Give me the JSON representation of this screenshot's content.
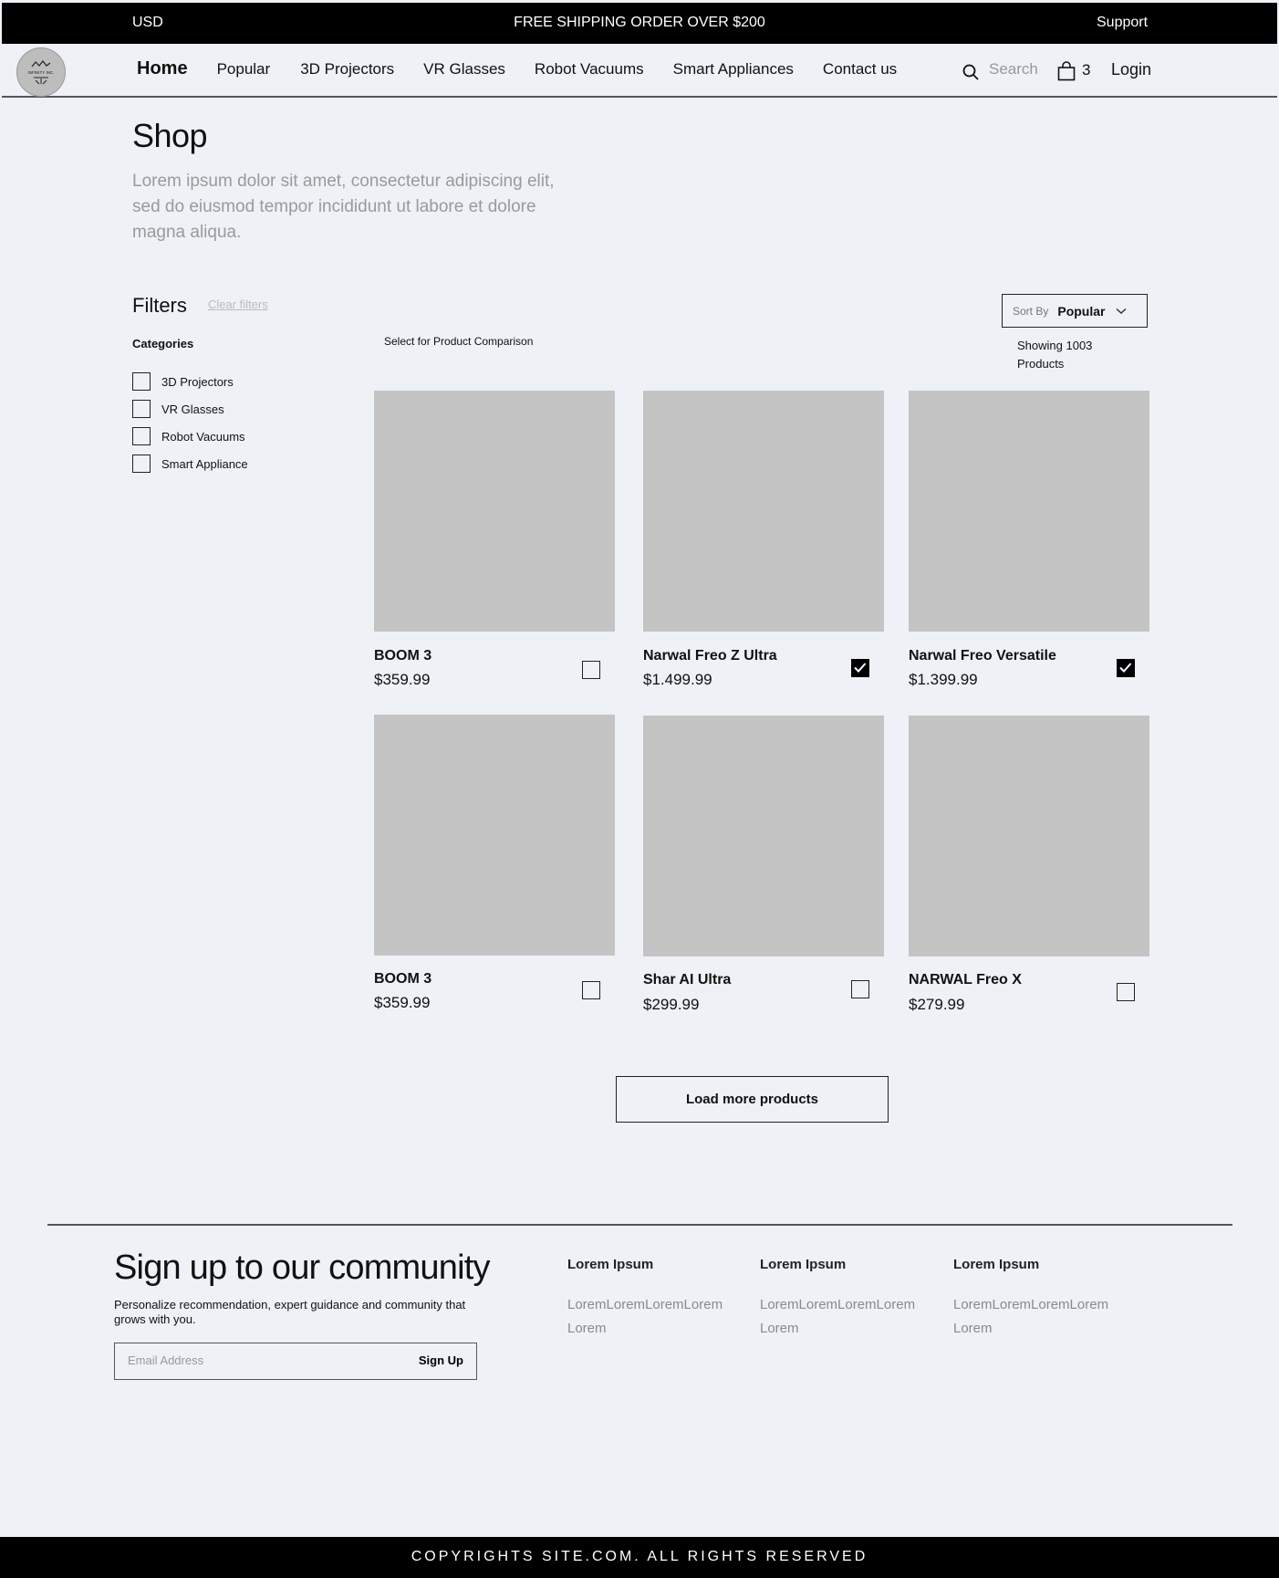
{
  "topbar": {
    "currency": "USD",
    "promo": "FREE SHIPPING ORDER OVER $200",
    "support": "Support"
  },
  "nav": {
    "logo_text": "INFINITY INC.",
    "links": [
      "Home",
      "Popular",
      "3D Projectors",
      "VR Glasses",
      "Robot Vacuums",
      "Smart Appliances",
      "Contact us"
    ],
    "search_placeholder": "Search",
    "cart_count": "3",
    "login": "Login"
  },
  "hero": {
    "title": "Shop",
    "description": "Lorem ipsum dolor sit amet, consectetur adipiscing elit, sed do eiusmod tempor incididunt ut labore et dolore magna aliqua."
  },
  "filters": {
    "title": "Filters",
    "clear": "Clear filters",
    "categories_title": "Categories",
    "categories": [
      {
        "label": "3D Projectors",
        "checked": false
      },
      {
        "label": "VR Glasses",
        "checked": false
      },
      {
        "label": "Robot Vacuums",
        "checked": false
      },
      {
        "label": "Smart Appliance",
        "checked": false
      }
    ]
  },
  "compare_note": "Select for Product Comparison",
  "sort": {
    "label": "Sort By",
    "value": "Popular"
  },
  "showing": "Showing 1003 Products",
  "products": [
    {
      "name": "BOOM 3",
      "price": "$359.99",
      "compare": false
    },
    {
      "name": "Narwal Freo Z Ultra",
      "price": "$1.499.99",
      "compare": true
    },
    {
      "name": "Narwal Freo Versatile",
      "price": "$1.399.99",
      "compare": true
    },
    {
      "name": "BOOM 3",
      "price": "$359.99",
      "compare": false
    },
    {
      "name": "Shar AI Ultra",
      "price": "$299.99",
      "compare": false
    },
    {
      "name": "NARWAL Freo X",
      "price": "$279.99",
      "compare": false
    }
  ],
  "load_more": "Load more products",
  "footer": {
    "signup_title": "Sign up to our community",
    "signup_desc": "Personalize recommendation, expert guidance and community that grows with you.",
    "email_placeholder": "Email Address",
    "signup_button": "Sign Up",
    "columns": [
      {
        "heading": "Lorem Ipsum",
        "text": "LoremLoremLoremLorem Lorem"
      },
      {
        "heading": "Lorem Ipsum",
        "text": "LoremLoremLoremLorem Lorem"
      },
      {
        "heading": "Lorem Ipsum",
        "text": "LoremLoremLoremLorem Lorem"
      }
    ],
    "copyright": "COPYRIGHTS SITE.COM. ALL RIGHTS RESERVED"
  }
}
